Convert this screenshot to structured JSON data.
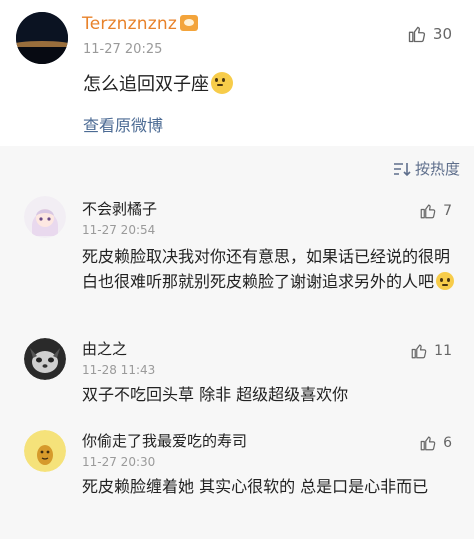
{
  "main_comment": {
    "username": "Terznznznz",
    "badge_icon": "vip-badge-icon",
    "time": "11-27 20:25",
    "likes": "30",
    "text": "怎么追回双子座",
    "emoji_icon": "pleading-face-emoji",
    "view_original_label": "查看原微博"
  },
  "sort": {
    "label": "按热度",
    "icon": "sort-icon"
  },
  "replies": [
    {
      "name": "不会剥橘子",
      "time": "11-27 20:54",
      "likes": "7",
      "text": "死皮赖脸取决我对你还有意思，如果话已经说的很明白也很难听那就别死皮赖脸了谢谢追求另外的人吧",
      "avatar_icon": "anime-girl-avatar"
    },
    {
      "name": "由之之",
      "time": "11-28 11:43",
      "likes": "11",
      "text": "双子不吃回头草 除非 超级超级喜欢你",
      "avatar_icon": "pet-photo-avatar"
    },
    {
      "name": "你偷走了我最爱吃的寿司",
      "time": "11-27 20:30",
      "likes": "6",
      "text": "死皮赖脸缠着她 其实心很软的 总是口是心非而已",
      "avatar_icon": "yellow-cartoon-avatar"
    }
  ],
  "colors": {
    "username_main": "#e8822a",
    "link": "#4c6b94",
    "panel_bg": "#f7f7f7"
  }
}
